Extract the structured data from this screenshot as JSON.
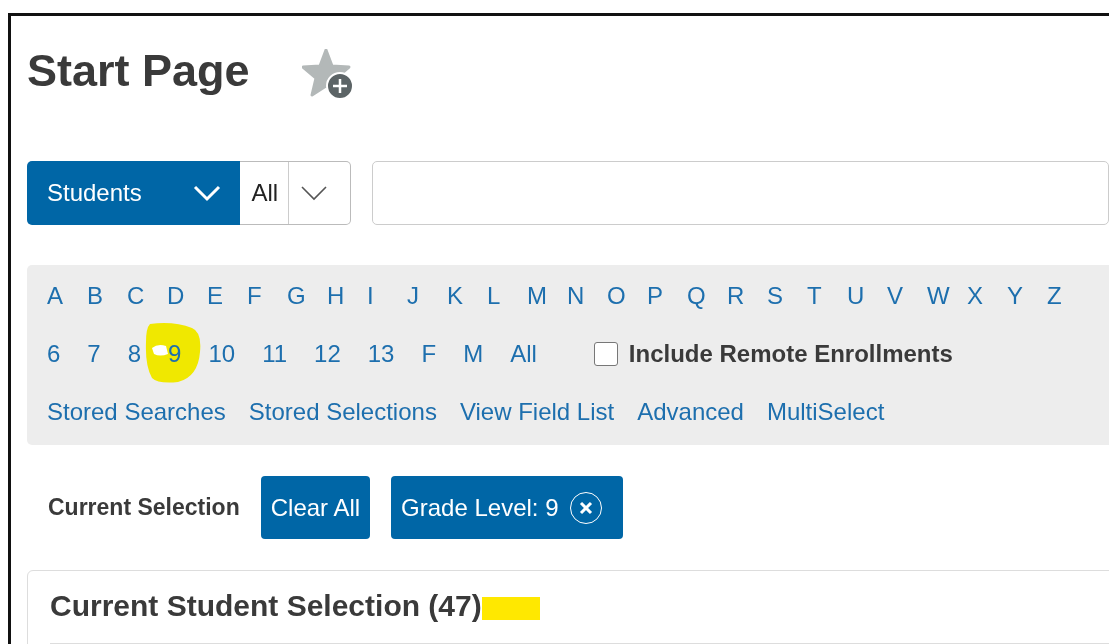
{
  "page": {
    "title": "Start Page"
  },
  "search": {
    "category": "Students",
    "scope": "All"
  },
  "letters": [
    "A",
    "B",
    "C",
    "D",
    "E",
    "F",
    "G",
    "H",
    "I",
    "J",
    "K",
    "L",
    "M",
    "N",
    "O",
    "P",
    "Q",
    "R",
    "S",
    "T",
    "U",
    "V",
    "W",
    "X",
    "Y",
    "Z"
  ],
  "grades": [
    {
      "label": "6",
      "highlighted": false
    },
    {
      "label": "7",
      "highlighted": false
    },
    {
      "label": "8",
      "highlighted": false
    },
    {
      "label": "9",
      "highlighted": true
    },
    {
      "label": "10",
      "highlighted": false
    },
    {
      "label": "11",
      "highlighted": false
    },
    {
      "label": "12",
      "highlighted": false
    },
    {
      "label": "13",
      "highlighted": false
    },
    {
      "label": "F",
      "highlighted": false
    },
    {
      "label": "M",
      "highlighted": false
    },
    {
      "label": "All",
      "highlighted": false
    }
  ],
  "remote_enrollments": {
    "label": "Include Remote Enrollments",
    "checked": false
  },
  "links": [
    "Stored Searches",
    "Stored Selections",
    "View Field List",
    "Advanced",
    "MultiSelect"
  ],
  "current_selection": {
    "label": "Current Selection",
    "clear_button": "Clear All",
    "filters": [
      {
        "label": "Grade Level: 9"
      }
    ]
  },
  "card": {
    "title": "Current Student Selection (47)",
    "highlighted": true
  }
}
